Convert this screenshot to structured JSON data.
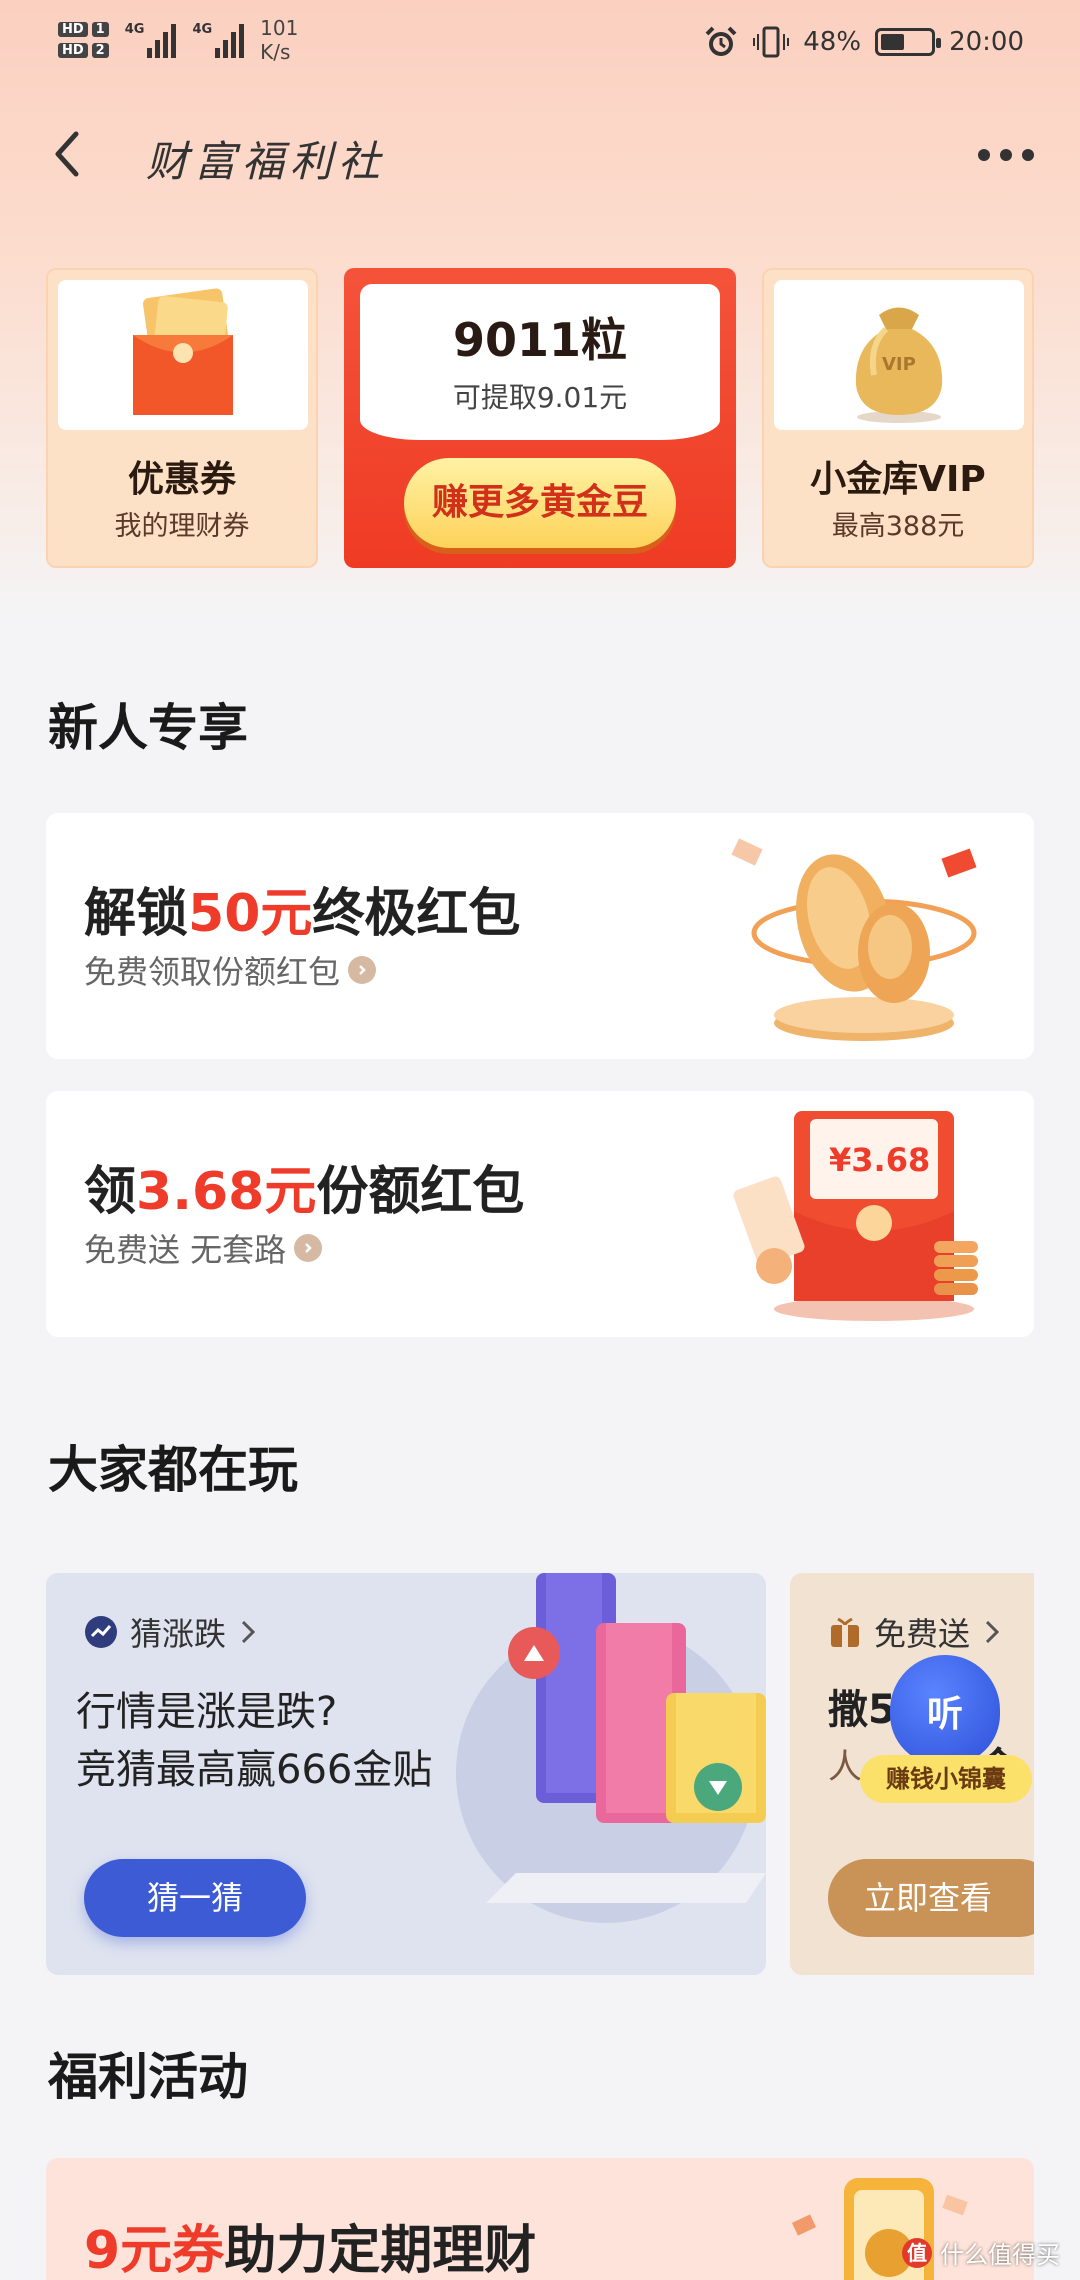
{
  "status_bar": {
    "hd1": "HD",
    "hd1_n": "1",
    "hd2": "HD",
    "hd2_n": "2",
    "signal1_label": "4G",
    "signal2_label": "4G",
    "net_speed_value": "101",
    "net_speed_unit": "K/s",
    "battery_percent_text": "48%",
    "battery_level": 0.48,
    "time": "20:00"
  },
  "header": {
    "title": "财富福利社"
  },
  "top_cards": {
    "coupon": {
      "title": "优惠券",
      "subtitle": "我的理财券"
    },
    "beans": {
      "count": "9011粒",
      "withdraw": "可提取9.01元",
      "button": "赚更多黄金豆"
    },
    "vip": {
      "title": "小金库VIP",
      "subtitle": "最高388元",
      "bag_label": "VIP"
    }
  },
  "newbie": {
    "section_title": "新人专享",
    "card1": {
      "pre": "解锁",
      "highlight": "50元",
      "post": "终极红包",
      "sub": "免费领取份额红包"
    },
    "card2": {
      "pre": "领",
      "highlight": "3.68元",
      "post": "份额红包",
      "sub": "免费送 无套路",
      "envelope_amount": "¥3.68"
    }
  },
  "popular": {
    "section_title": "大家都在玩",
    "card1": {
      "tag": "猜涨跌",
      "line1": "行情是涨是跌?",
      "line2": "竞猜最高赢666金贴",
      "button": "猜一猜"
    },
    "card2": {
      "tag": "免费送",
      "line1": "撒5",
      "line1_tail": "黄金",
      "line2": "人",
      "overlay_badge": "听",
      "overlay_label": "赚钱小锦囊",
      "button": "立即查看"
    }
  },
  "welfare": {
    "section_title": "福利活动",
    "card1": {
      "highlight": "9元券",
      "post": "助力定期理财"
    }
  },
  "watermark": {
    "logo": "值",
    "text": "什么值得买"
  },
  "colors": {
    "accent_red": "#ef3b2a",
    "gold_button": "#fdd25a",
    "blue_button": "#3e5bd6",
    "brown_button": "#c99256"
  }
}
